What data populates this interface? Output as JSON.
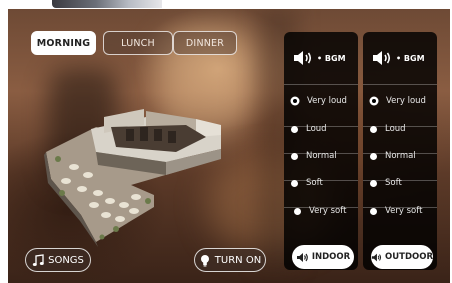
{
  "meal_tabs": [
    {
      "label": "MORNING",
      "active": true
    },
    {
      "label": "LUNCH",
      "active": false
    },
    {
      "label": "DINNER",
      "active": false
    }
  ],
  "bgm_label": "• BGM",
  "volume_options": [
    "Very loud",
    "Loud",
    "Normal",
    "Soft",
    "Very soft"
  ],
  "indoor": {
    "selected": "Very loud",
    "button_label": "INDOOR"
  },
  "outdoor": {
    "selected": "Very loud",
    "button_label": "OUTDOOR"
  },
  "songs_label": "SONGS",
  "turn_on_label": "TURN ON",
  "icons": {
    "speaker": "speaker-icon",
    "music": "music-note-icon",
    "bulb": "lightbulb-icon"
  },
  "colors": {
    "panel": "#000000",
    "active_tab": "#ffffff",
    "text": "#ffffff"
  }
}
